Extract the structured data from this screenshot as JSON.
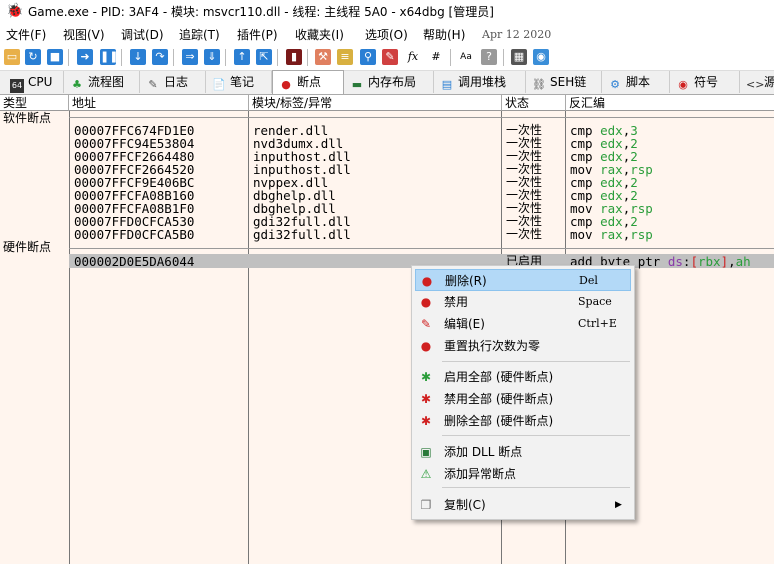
{
  "window": {
    "title": "Game.exe - PID: 3AF4 - 模块: msvcr110.dll - 线程: 主线程 5A0 - x64dbg [管理员]"
  },
  "menu": {
    "items": [
      "文件(F)",
      "视图(V)",
      "调试(D)",
      "追踪(T)",
      "插件(P)",
      "收藏夹(I)",
      "选项(O)",
      "帮助(H)"
    ],
    "date": "Apr 12 2020"
  },
  "tabs": [
    {
      "label": "CPU",
      "icon": "cpu-icon"
    },
    {
      "label": "流程图",
      "icon": "tree-icon"
    },
    {
      "label": "日志",
      "icon": "log-icon"
    },
    {
      "label": "笔记",
      "icon": "notes-icon"
    },
    {
      "label": "断点",
      "icon": "breakpoint-icon"
    },
    {
      "label": "内存布局",
      "icon": "memory-icon"
    },
    {
      "label": "调用堆栈",
      "icon": "callstack-icon"
    },
    {
      "label": "SEH链",
      "icon": "seh-icon"
    },
    {
      "label": "脚本",
      "icon": "script-icon"
    },
    {
      "label": "符号",
      "icon": "symbol-icon"
    },
    {
      "label": "源",
      "icon": "source-icon"
    }
  ],
  "table": {
    "headers": [
      "类型",
      "地址",
      "模块/标签/异常",
      "状态",
      "反汇编"
    ],
    "software_section": "软件断点",
    "hardware_section": "硬件断点",
    "software_rows": [
      {
        "address": "00007FFC674FD1E0",
        "module": "render.dll",
        "state": "一次性",
        "mnemonic": "cmp",
        "op1": "edx",
        "op2": "3"
      },
      {
        "address": "00007FFC94E53804",
        "module": "nvd3dumx.dll",
        "state": "一次性",
        "mnemonic": "cmp",
        "op1": "edx",
        "op2": "2"
      },
      {
        "address": "00007FFCF2664480",
        "module": "inputhost.dll",
        "state": "一次性",
        "mnemonic": "cmp",
        "op1": "edx",
        "op2": "2"
      },
      {
        "address": "00007FFCF2664520",
        "module": "inputhost.dll",
        "state": "一次性",
        "mnemonic": "mov",
        "op1": "rax",
        "op2": "rsp"
      },
      {
        "address": "00007FFCF9E406BC",
        "module": "nvppex.dll",
        "state": "一次性",
        "mnemonic": "cmp",
        "op1": "edx",
        "op2": "2"
      },
      {
        "address": "00007FFCFA08B160",
        "module": "dbghelp.dll",
        "state": "一次性",
        "mnemonic": "cmp",
        "op1": "edx",
        "op2": "2"
      },
      {
        "address": "00007FFCFA08B1F0",
        "module": "dbghelp.dll",
        "state": "一次性",
        "mnemonic": "mov",
        "op1": "rax",
        "op2": "rsp"
      },
      {
        "address": "00007FFD0CFCA530",
        "module": "gdi32full.dll",
        "state": "一次性",
        "mnemonic": "cmp",
        "op1": "edx",
        "op2": "2"
      },
      {
        "address": "00007FFD0CFCA5B0",
        "module": "gdi32full.dll",
        "state": "一次性",
        "mnemonic": "mov",
        "op1": "rax",
        "op2": "rsp"
      }
    ],
    "hardware_rows": [
      {
        "address": "000002D0E5DA6044",
        "module": "",
        "state": "已启用",
        "mnemonic": "add",
        "size": "byte ptr",
        "seg": "ds",
        "reg": "rbx",
        "op2": "ah"
      }
    ]
  },
  "context_menu": {
    "items": [
      {
        "label": "删除(R)",
        "shortcut": "Del",
        "icon": "delete-breakpoint-icon"
      },
      {
        "label": "禁用",
        "shortcut": "Space",
        "icon": "disable-breakpoint-icon"
      },
      {
        "label": "编辑(E)",
        "shortcut": "Ctrl+E",
        "icon": "edit-breakpoint-icon"
      },
      {
        "label": "重置执行次数为零",
        "shortcut": "",
        "icon": "reset-hitcount-icon"
      },
      {
        "label": "启用全部 (硬件断点)",
        "shortcut": "",
        "icon": "enable-all-icon"
      },
      {
        "label": "禁用全部 (硬件断点)",
        "shortcut": "",
        "icon": "disable-all-icon"
      },
      {
        "label": "删除全部 (硬件断点)",
        "shortcut": "",
        "icon": "delete-all-icon"
      },
      {
        "label": "添加 DLL 断点",
        "shortcut": "",
        "icon": "add-dll-breakpoint-icon"
      },
      {
        "label": "添加异常断点",
        "shortcut": "",
        "icon": "add-exception-breakpoint-icon"
      },
      {
        "label": "复制(C)",
        "shortcut": "",
        "icon": "copy-icon"
      }
    ]
  },
  "colors": {
    "background": "#fff5ee",
    "selection": "#c0c0c0",
    "menu_hover": "#b3d9f7",
    "register": "#2a9d3a",
    "segment": "#8a3aa8",
    "bracket": "#d02020"
  }
}
